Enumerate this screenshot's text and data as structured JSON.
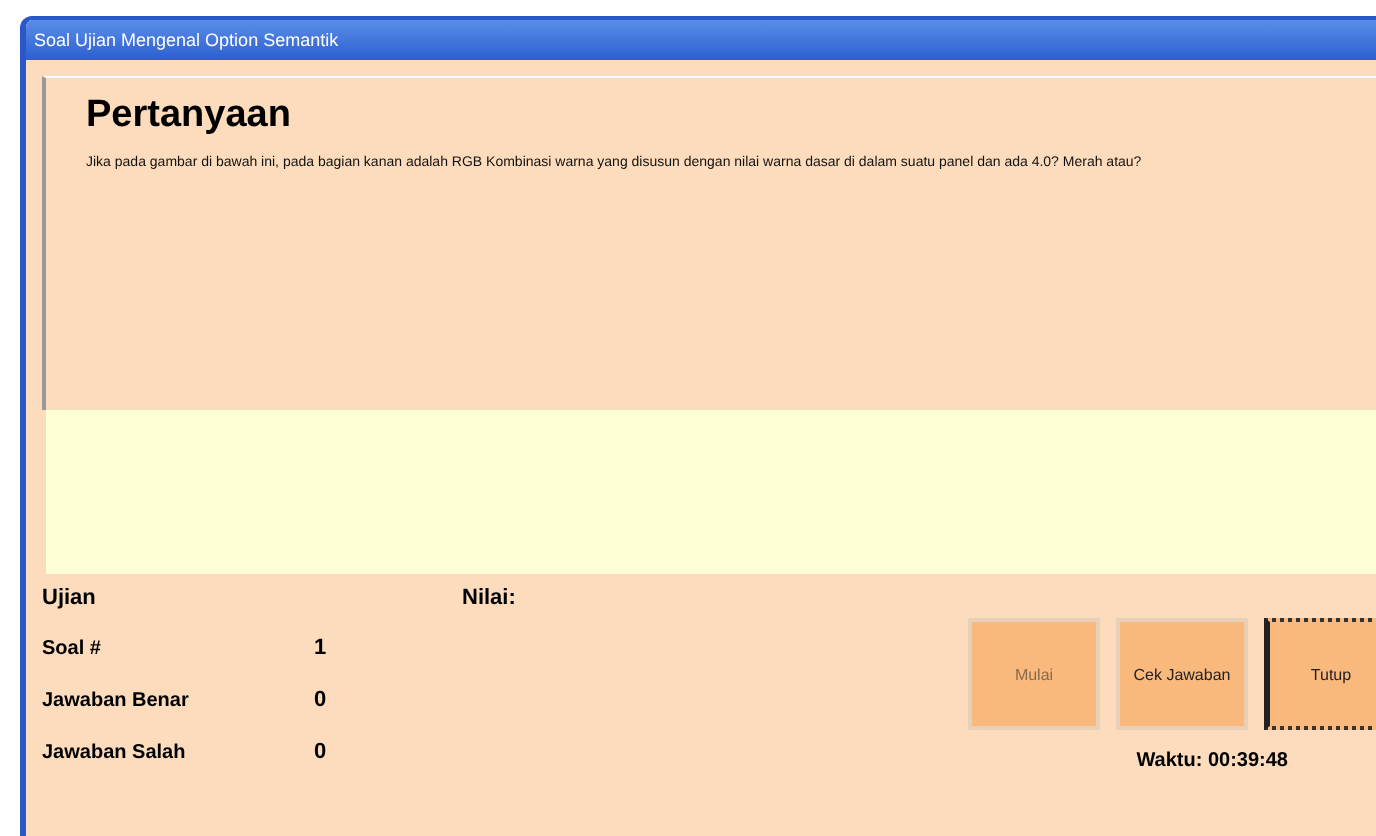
{
  "window": {
    "title": "Soal Ujian Mengenal Option Semantik"
  },
  "question": {
    "heading": "Pertanyaan",
    "text": "Jika pada gambar di bawah ini, pada bagian kanan adalah RGB Kombinasi warna yang disusun dengan nilai warna dasar di dalam suatu panel dan ada 4.0? Merah atau?"
  },
  "exam": {
    "label": "Ujian",
    "score_label": "Nilai:",
    "rows": [
      {
        "label": "Soal #",
        "value": "1"
      },
      {
        "label": "Jawaban Benar",
        "value": "0"
      },
      {
        "label": "Jawaban Salah",
        "value": "0"
      }
    ]
  },
  "buttons": [
    {
      "label": "Mulai",
      "disabled": true,
      "focused": false
    },
    {
      "label": "Cek Jawaban",
      "disabled": false,
      "focused": false
    },
    {
      "label": "Tutup",
      "disabled": false,
      "focused": true
    }
  ],
  "timer": "Waktu: 00:39:48"
}
